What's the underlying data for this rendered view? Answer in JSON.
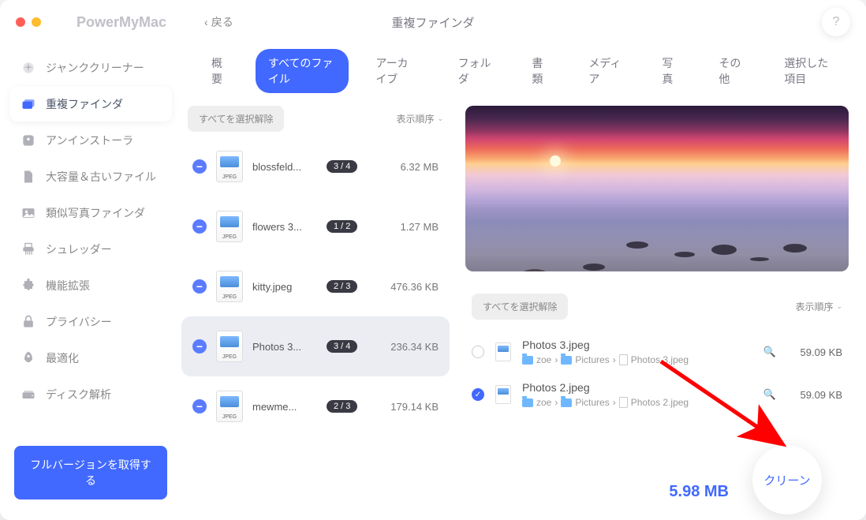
{
  "app_name": "PowerMyMac",
  "back_label": "戻る",
  "window_title": "重複ファインダ",
  "help_label": "?",
  "sidebar": {
    "items": [
      {
        "label": "ジャンククリーナー"
      },
      {
        "label": "重複ファインダ"
      },
      {
        "label": "アンインストーラ"
      },
      {
        "label": "大容量＆古いファイル"
      },
      {
        "label": "類似写真ファインダ"
      },
      {
        "label": "シュレッダー"
      },
      {
        "label": "機能拡張"
      },
      {
        "label": "プライバシー"
      },
      {
        "label": "最適化"
      },
      {
        "label": "ディスク解析"
      }
    ],
    "full_version": "フルバージョンを取得する"
  },
  "tabs": [
    "概要",
    "すべてのファイル",
    "アーカイブ",
    "フォルダ",
    "書類",
    "メディア",
    "写真",
    "その他",
    "選択した項目"
  ],
  "list": {
    "deselect_all": "すべてを選択解除",
    "sort_label": "表示順序",
    "items": [
      {
        "name": "blossfeld...",
        "badge": "3 / 4",
        "size": "6.32 MB"
      },
      {
        "name": "flowers 3...",
        "badge": "1 / 2",
        "size": "1.27 MB"
      },
      {
        "name": "kitty.jpeg",
        "badge": "2 / 3",
        "size": "476.36 KB"
      },
      {
        "name": "Photos 3...",
        "badge": "3 / 4",
        "size": "236.34 KB"
      },
      {
        "name": "mewme...",
        "badge": "2 / 3",
        "size": "179.14 KB"
      }
    ],
    "icon_ext": "JPEG"
  },
  "detail": {
    "deselect_all": "すべてを選択解除",
    "sort_label": "表示順序",
    "rows": [
      {
        "checked": false,
        "name": "Photos 3.jpeg",
        "path_user": "zoe",
        "path_folder": "Pictures",
        "path_file": "Photos 3.jpeg",
        "size": "59.09 KB"
      },
      {
        "checked": true,
        "name": "Photos 2.jpeg",
        "path_user": "zoe",
        "path_folder": "Pictures",
        "path_file": "Photos 2.jpeg",
        "size": "59.09 KB"
      }
    ]
  },
  "footer": {
    "total": "5.98 MB",
    "clean": "クリーン"
  },
  "path_sep": "›"
}
